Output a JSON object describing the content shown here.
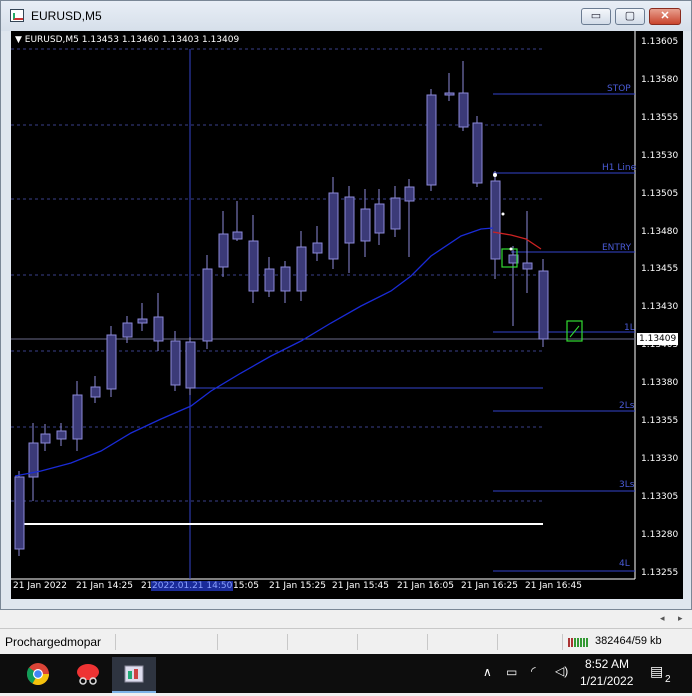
{
  "window": {
    "title": "EURUSD,M5",
    "min_glyph": "▭",
    "max_glyph": "▢",
    "close_glyph": "✕"
  },
  "chart": {
    "symbol_info": "▼ EURUSD,M5  1.13453 1.13460 1.13403 1.13409",
    "price_labels": [
      "1.13605",
      "1.13580",
      "1.13555",
      "1.13530",
      "1.13505",
      "1.13480",
      "1.13455",
      "1.13430",
      "1.13405",
      "1.13380",
      "1.13355",
      "1.13330",
      "1.13305",
      "1.13280",
      "1.13255"
    ],
    "current_price": "1.13409",
    "time_labels": [
      "21 Jan 2022",
      "21 Jan 14:25",
      "21",
      "15:05",
      "21 Jan 15:25",
      "21 Jan 15:45",
      "21 Jan 16:05",
      "21 Jan 16:25",
      "21 Jan 16:45"
    ],
    "crosshair_time": "2022.01.21 14:50",
    "levels": {
      "stop": "STOP",
      "h1": "H1 Line",
      "entry": "ENTRY",
      "l1": "1L",
      "l2": "2Ls",
      "l3": "3Ls",
      "l4": "4L"
    },
    "colors": {
      "background": "#000000",
      "candle_fill": "#3b3a78",
      "candle_outline": "#8c8ad8",
      "moving_average": "#1a2bd6",
      "level_line": "#3344cc",
      "grid": "#3a3f8a"
    }
  },
  "status": {
    "user": "Prochargedmopar",
    "traffic": "382464/59 kb"
  },
  "taskbar": {
    "time": "8:52 AM",
    "date": "1/21/2022",
    "notifications": "2"
  }
}
